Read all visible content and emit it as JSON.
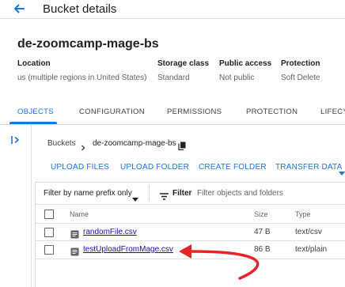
{
  "header": {
    "title": "Bucket details"
  },
  "bucket": {
    "name": "de-zoomcamp-mage-bs"
  },
  "meta": [
    {
      "label": "Location",
      "value": "us (multiple regions in United States)"
    },
    {
      "label": "Storage class",
      "value": "Standard"
    },
    {
      "label": "Public access",
      "value": "Not public"
    },
    {
      "label": "Protection",
      "value": "Soft Delete"
    }
  ],
  "tabs": [
    {
      "label": "OBJECTS",
      "active": true
    },
    {
      "label": "CONFIGURATION",
      "active": false
    },
    {
      "label": "PERMISSIONS",
      "active": false
    },
    {
      "label": "PROTECTION",
      "active": false
    },
    {
      "label": "LIFECY",
      "active": false
    }
  ],
  "breadcrumb": {
    "root": "Buckets",
    "current": "de-zoomcamp-mage-bs"
  },
  "actions": [
    "UPLOAD FILES",
    "UPLOAD FOLDER",
    "CREATE FOLDER",
    "TRANSFER DATA"
  ],
  "filter": {
    "select_label": "Filter by name prefix only",
    "label": "Filter",
    "placeholder": "Filter objects and folders"
  },
  "table": {
    "columns": [
      "Name",
      "Size",
      "Type"
    ],
    "rows": [
      {
        "name": "randomFile.csv",
        "size": "47 B",
        "type": "text/csv"
      },
      {
        "name": "testUploadFromMage.csv",
        "size": "86 B",
        "type": "text/plain"
      }
    ]
  },
  "colors": {
    "accent": "#1a73e8",
    "annotation_arrow": "#e8232a",
    "link": "#1a0dab"
  },
  "icons": [
    "back-arrow-icon",
    "expand-panel-icon",
    "chevron-right-icon",
    "copy-icon",
    "caret-down-icon",
    "filter-icon",
    "file-icon"
  ]
}
